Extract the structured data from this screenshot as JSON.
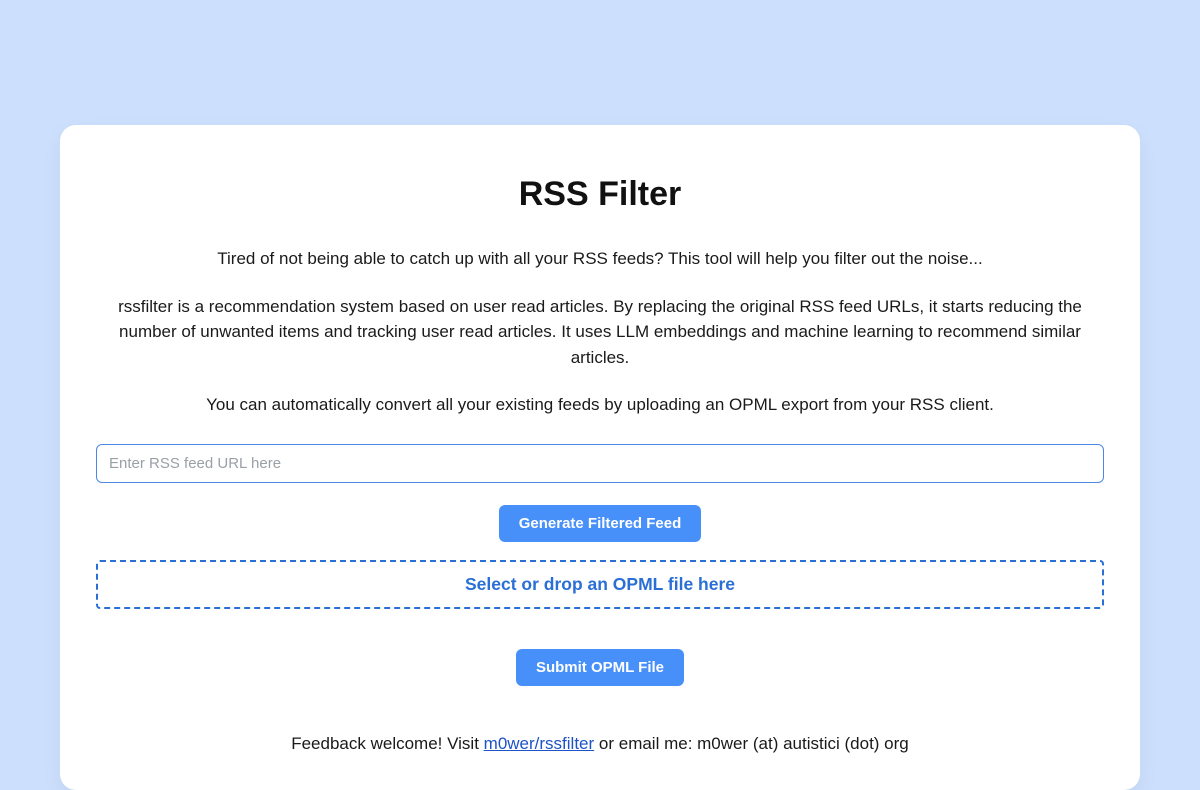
{
  "title": "RSS Filter",
  "intro": "Tired of not being able to catch up with all your RSS feeds? This tool will help you filter out the noise...",
  "desc": "rssfilter is a recommendation system based on user read articles. By replacing the original RSS feed URLs, it starts reducing the number of unwanted items and tracking user read articles. It uses LLM embeddings and machine learning to recommend similar articles.",
  "desc2": "You can automatically convert all your existing feeds by uploading an OPML export from your RSS client.",
  "url_input": {
    "placeholder": "Enter RSS feed URL here",
    "value": ""
  },
  "generate_button": "Generate Filtered Feed",
  "dropzone_label": "Select or drop an OPML file here",
  "submit_button": "Submit OPML File",
  "footer": {
    "prefix": "Feedback welcome! Visit ",
    "link_text": "m0wer/rssfilter",
    "suffix": " or email me: m0wer (at) autistici (dot) org"
  }
}
